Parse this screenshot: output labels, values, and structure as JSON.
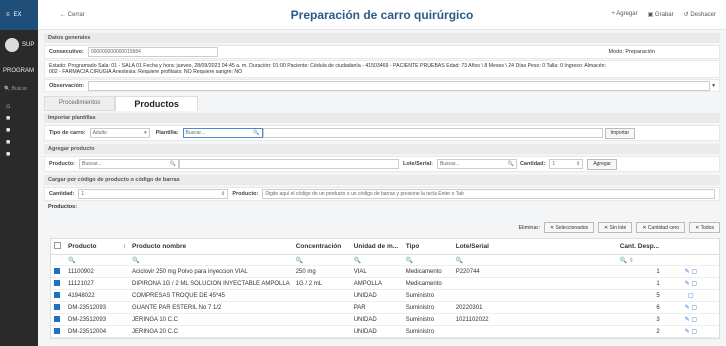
{
  "sidebar": {
    "brand": "EX",
    "user": "SUP",
    "program": "PROGRAM",
    "search": "Buscar"
  },
  "topbar": {
    "back": "← Cerrar",
    "title": "Preparación de carro quirúrgico",
    "add": "+ Agregar",
    "save": "Grabar",
    "undo": "Deshacer"
  },
  "general": {
    "heading": "Datos generales",
    "consec_label": "Consecutivo:",
    "consec_value": "000000000000015884",
    "mode": "Modo: Preparación",
    "status_line": "Estado: Programado Sala: 01 - SALA 01 Fecha y hora: jueves, 28/09/2023 04:45 a. m. Duración: 01:00 Paciente: Cédula de ciudadanía - 41503469 - PACIENTE PRUEBAS Edad: 73 Años \\ 8 Meses \\ 24 Días Peso: 0 Talla: 0 Ingreso: Almacén:",
    "status_line2": "002 - FARMACIA CIRUGIA Anestesia: Requiere profilaxis: NO Requiere sangre: NO",
    "obs_label": "Observación:"
  },
  "tabs": {
    "t1": "Procedimientos",
    "t2": "Productos"
  },
  "import": {
    "heading": "Importar plantillas",
    "cart_label": "Tipo de carro:",
    "cart_value": "Adulto",
    "template_label": "Plantilla:",
    "template_ph": "Buscar...",
    "button": "Importar"
  },
  "add": {
    "heading": "Agregar producto",
    "product_label": "Producto:",
    "product_ph": "Buscar...",
    "lot_label": "Lote/Serial:",
    "lot_ph": "Buscar...",
    "qty_label": "Cantidad:",
    "qty_value": "1",
    "button": "Agregar"
  },
  "barcode": {
    "heading": "Cargar por código de producto o código de barras",
    "qty_label": "Cantidad:",
    "qty_value": "1",
    "product_label": "Producto:",
    "ph": "Digite aquí el código de un producto o un código de barras y presione la tecla Enter o Tab"
  },
  "products_label": "Productos:",
  "actions": {
    "delete": "Eliminar:",
    "selected": "Seleccionados",
    "no_lot": "Sin lote",
    "zero": "Cantidad cero",
    "all": "Todos"
  },
  "table": {
    "headers": [
      "Producto",
      "Producto nombre",
      "Concentración",
      "Unidad de m...",
      "Tipo",
      "Lote/Serial",
      "Cant. Desp..."
    ],
    "rows": [
      [
        "11100902",
        "Aciclovir 250 mg Polvo para inyeccion VIAL",
        "250 mg",
        "VIAL",
        "Medicamento",
        "P220744",
        "1"
      ],
      [
        "11121027",
        "DIPIRONA 1G / 2 ML SOLUCION INYECTABLE AMPOLLA",
        "1G / 2 mL",
        "AMPOLLA",
        "Medicamento",
        "",
        "1"
      ],
      [
        "41948022",
        "COMPRESAS TROQUE DE 45*45",
        "",
        "UNIDAD",
        "Suministro",
        "",
        "5"
      ],
      [
        "DM-23512093",
        "GUANTE PAR ESTERIL No 7 1/2",
        "",
        "PAR",
        "Suministro",
        "20220301",
        "6"
      ],
      [
        "DM-23512093",
        "JERINGA 10 C.C",
        "",
        "UNIDAD",
        "Suministro",
        "1021102022",
        "3"
      ],
      [
        "DM-23512004",
        "JERINGA 20 C.C",
        "",
        "UNIDAD",
        "Suministro",
        "",
        "2"
      ]
    ]
  }
}
